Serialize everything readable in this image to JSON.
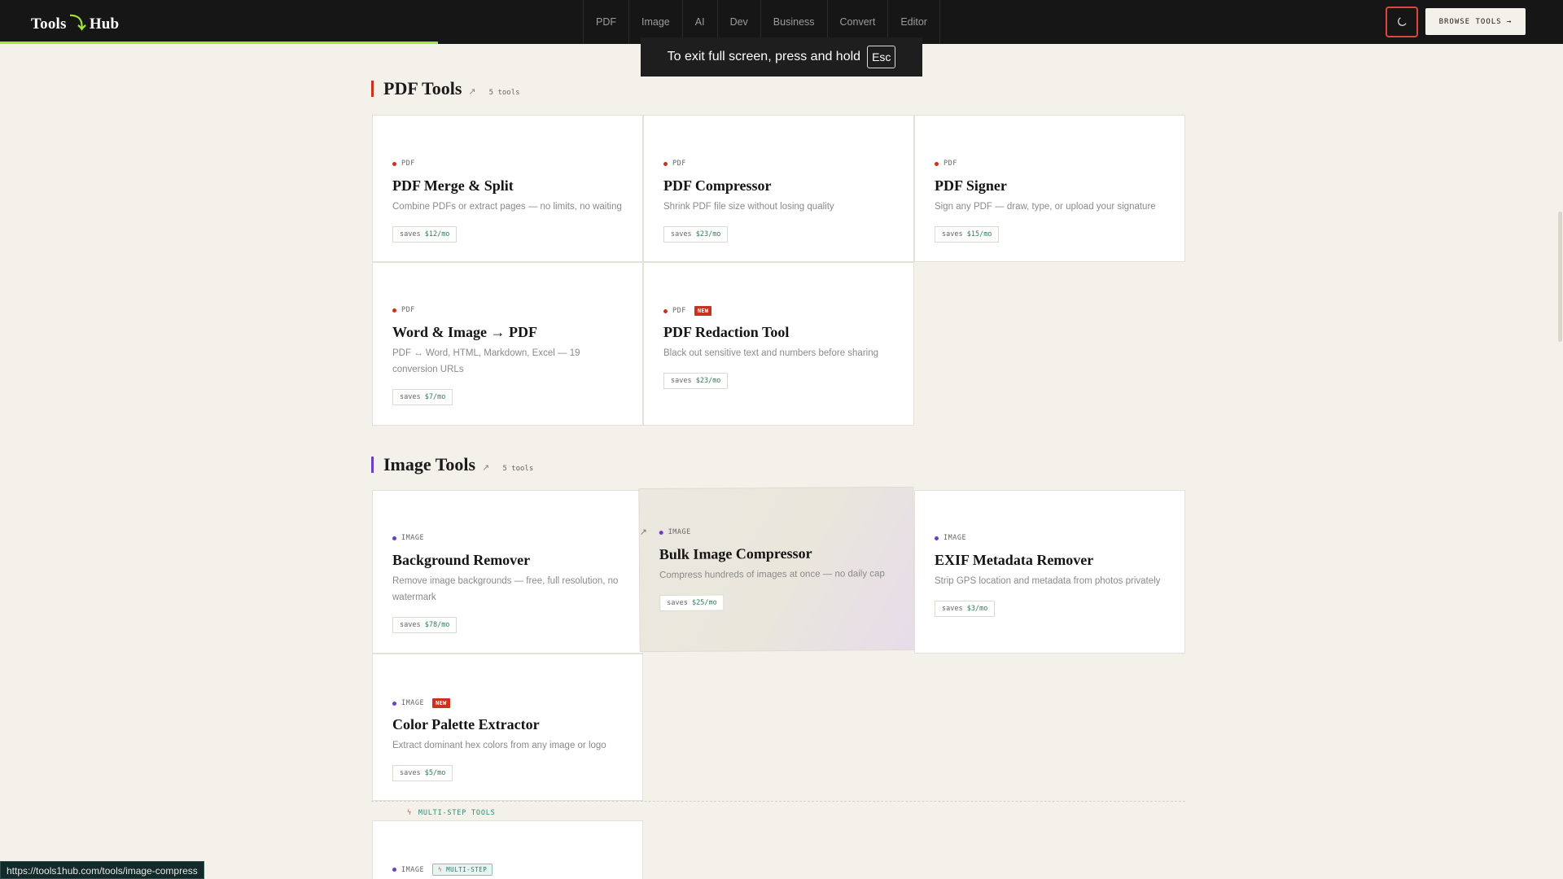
{
  "nav": {
    "logo_left": "Tools",
    "logo_mark": "⤵",
    "logo_right": "Hub",
    "links": [
      "PDF",
      "Image",
      "AI",
      "Dev",
      "Business",
      "Convert",
      "Editor"
    ],
    "browse_label": "BROWSE TOOLS →",
    "scroll_progress_percent": 28
  },
  "toast": {
    "text": "To exit full screen, press and hold",
    "key": "Esc"
  },
  "colors": {
    "accent": "#a3e635",
    "pdf": "#c8321e",
    "image": "#6b3fc4",
    "new": "#c8321e"
  },
  "pdf_section": {
    "title": "PDF Tools",
    "count": "5 tools",
    "cards": [
      {
        "cat": "PDF",
        "name": "PDF Merge & Split",
        "desc": "Combine PDFs or extract pages — no limits, no waiting",
        "saves_prefix": "saves",
        "saves": "$12/mo"
      },
      {
        "cat": "PDF",
        "name": "PDF Compressor",
        "desc": "Shrink PDF file size without losing quality",
        "saves_prefix": "saves",
        "saves": "$23/mo"
      },
      {
        "cat": "PDF",
        "name": "PDF Signer",
        "desc": "Sign any PDF — draw, type, or upload your signature",
        "saves_prefix": "saves",
        "saves": "$15/mo"
      },
      {
        "cat": "PDF",
        "name": "Word & Image → PDF",
        "desc": "PDF ↔ Word, HTML, Markdown, Excel — 19 conversion URLs",
        "saves_prefix": "saves",
        "saves": "$7/mo"
      },
      {
        "cat": "PDF",
        "badge": "NEW",
        "name": "PDF Redaction Tool",
        "desc": "Black out sensitive text and numbers before sharing",
        "saves_prefix": "saves",
        "saves": "$23/mo"
      }
    ]
  },
  "image_section": {
    "title": "Image Tools",
    "count": "5 tools",
    "cards": [
      {
        "cat": "IMAGE",
        "name": "Background Remover",
        "desc": "Remove image backgrounds — free, full resolution, no watermark",
        "saves_prefix": "saves",
        "saves": "$78/mo"
      },
      {
        "cat": "IMAGE",
        "name": "Bulk Image Compressor",
        "desc": "Compress hundreds of images at once — no daily cap",
        "saves_prefix": "saves",
        "saves": "$25/mo"
      },
      {
        "cat": "IMAGE",
        "name": "EXIF Metadata Remover",
        "desc": "Strip GPS location and metadata from photos privately",
        "saves_prefix": "saves",
        "saves": "$3/mo"
      },
      {
        "cat": "IMAGE",
        "badge": "NEW",
        "name": "Color Palette Extractor",
        "desc": "Extract dominant hex colors from any image or logo",
        "saves_prefix": "saves",
        "saves": "$5/mo"
      }
    ]
  },
  "multistep": {
    "label": "MULTI-STEP TOOLS",
    "card": {
      "cat": "IMAGE",
      "badge": "MULTI-STEP"
    }
  },
  "status_url": "https://tools1hub.com/tools/image-compress"
}
